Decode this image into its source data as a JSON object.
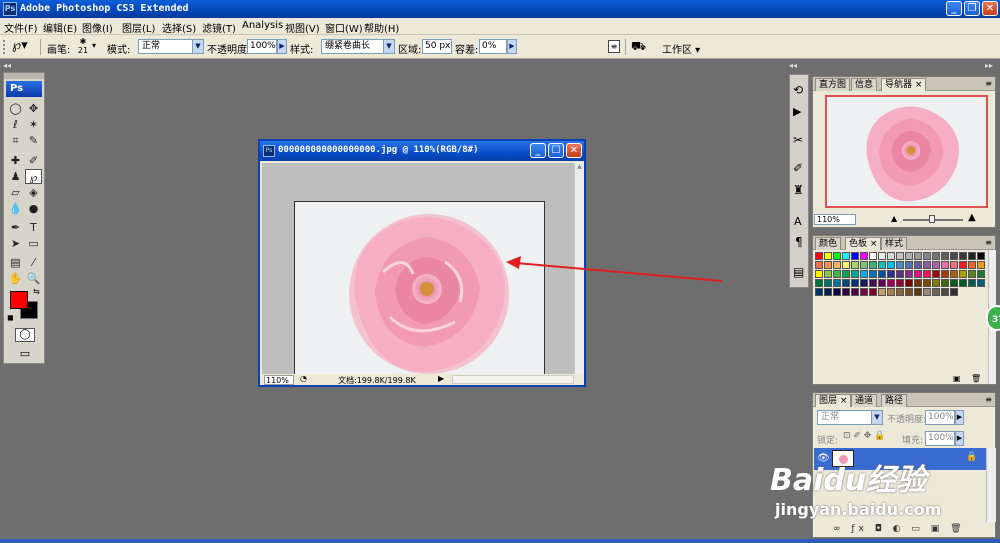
{
  "app": {
    "title": "Adobe Photoshop CS3 Extended",
    "logo": "Ps"
  },
  "menu": [
    "文件(F)",
    "编辑(E)",
    "图像(I)",
    "图层(L)",
    "选择(S)",
    "滤镜(T)",
    "Analysis",
    "视图(V)",
    "窗口(W)",
    "帮助(H)"
  ],
  "options": {
    "brush_label": "画笔:",
    "brush_size": "21",
    "mode_label": "模式:",
    "mode_value": "正常",
    "opacity_label": "不透明度:",
    "opacity_value": "100%",
    "style_label": "样式:",
    "style_value": "绷紧卷曲长",
    "area_label": "区域:",
    "area_value": "50 px",
    "tolerance_label": "容差:",
    "tolerance_value": "0%",
    "workspace_label": "工作区 ▾"
  },
  "document": {
    "title": "000000000000000000.jpg @ 110%(RGB/8#)",
    "zoom": "110%",
    "doc_size": "文档:199.8K/199.8K"
  },
  "navigator": {
    "tabs": [
      "直方图",
      "信息",
      "导航器 ×"
    ],
    "zoom_value": "110%"
  },
  "swatches": {
    "tabs": [
      "颜色",
      "色板 ×",
      "样式"
    ]
  },
  "layers": {
    "tabs": [
      "图层 ×",
      "通道",
      "路径"
    ],
    "blend_mode": "正常",
    "opacity_label": "不透明度:",
    "opacity_value": "100%",
    "lock_label": "锁定:",
    "fill_label": "填充:",
    "fill_value": "100%"
  },
  "colors": {
    "foreground": "#ff0000",
    "background": "#000000",
    "arrow": "#e02020",
    "accent": "#0a5fd8"
  },
  "side_badge": "37",
  "watermark": {
    "brand": "Baidu经验",
    "url": "jingyan.baidu.com"
  }
}
